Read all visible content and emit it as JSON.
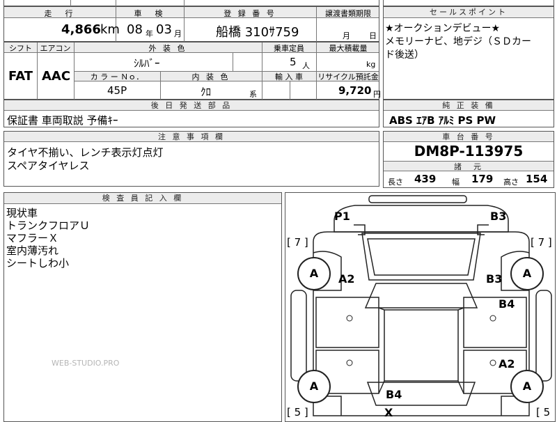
{
  "top_row": {
    "partial_left": "",
    "partial_mid": "",
    "partial_right": ""
  },
  "row1": {
    "mileage_header": "走　行",
    "mileage_value": "4,866",
    "mileage_unit": "km",
    "inspection_header": "車　検",
    "inspection_year": "08",
    "inspection_year_unit": "年",
    "inspection_month": "03",
    "inspection_month_unit": "月",
    "reg_header": "登 録 番 号",
    "reg_value": "船橋 310ｻ759",
    "transfer_header": "譲渡書類期限",
    "transfer_month": "月",
    "transfer_day": "日"
  },
  "row2": {
    "shift_header": "シフト",
    "shift_value": "FAT",
    "ac_header": "エアコン",
    "ac_value": "AAC",
    "ext_color_header": "外 装 色",
    "ext_color_value": "ｼﾙﾊﾞｰ",
    "capacity_header": "乗車定員",
    "capacity_value": "5",
    "capacity_unit": "人",
    "load_header": "最大積載量",
    "load_unit": "kg",
    "color_no_header": "カ ラ ー Ｎｏ．",
    "color_no_value": "45P",
    "int_color_header": "内 装 色",
    "int_color_value": "ｸﾛ",
    "int_color_suffix": "系",
    "import_header": "輸 入 車",
    "recycle_header": "リサイクル預託金",
    "recycle_value": "9,720",
    "recycle_unit": "円"
  },
  "sales_point": {
    "header": "セールスポイント",
    "lines": [
      "★オークションデビュー★",
      "メモリーナビ、地デジ（ＳＤカー",
      "ド後送）"
    ]
  },
  "delivery_later": {
    "header": "後 日 発 送 部 品",
    "value": "保証書 車両取説 予備ｷｰ"
  },
  "standard_equipment": {
    "header": "純 正 装 備",
    "value": "ABS ｴｱB ｱﾙﾐ PS PW"
  },
  "notes": {
    "header": "注 意 事 項 欄",
    "lines": [
      "タイヤ不揃い、レンチ表示灯点灯",
      "スペアタイヤレス"
    ]
  },
  "chassis": {
    "header": "車 台 番 号",
    "value": "DM8P-113975"
  },
  "specs": {
    "header": "諸　元",
    "length_label": "長さ",
    "length_value": "439",
    "width_label": "幅",
    "width_value": "179",
    "height_label": "高さ",
    "height_value": "154"
  },
  "inspector": {
    "header": "検 査 員 記 入 欄",
    "lines": [
      "現状車",
      "トランクフロアＵ",
      "マフラーＸ",
      "室内薄汚れ",
      "シートしわ小"
    ],
    "watermark": "WEB-STUDIO.PRO"
  },
  "diagram": {
    "marks": {
      "p1": "P1",
      "b3_top": "B3",
      "a2_left": "A2",
      "b3_right": "B3",
      "b4_right": "B4",
      "a2_right": "A2",
      "b4_bottom": "B4",
      "x_bottom": "X"
    },
    "tires": {
      "fl": "A",
      "fr": "A",
      "rl": "A",
      "rr": "A"
    },
    "tread": {
      "fl": "[ 7 ]",
      "fr": "[ 7 ]",
      "rl": "[ 5 ]",
      "rr": "[ 5"
    }
  }
}
